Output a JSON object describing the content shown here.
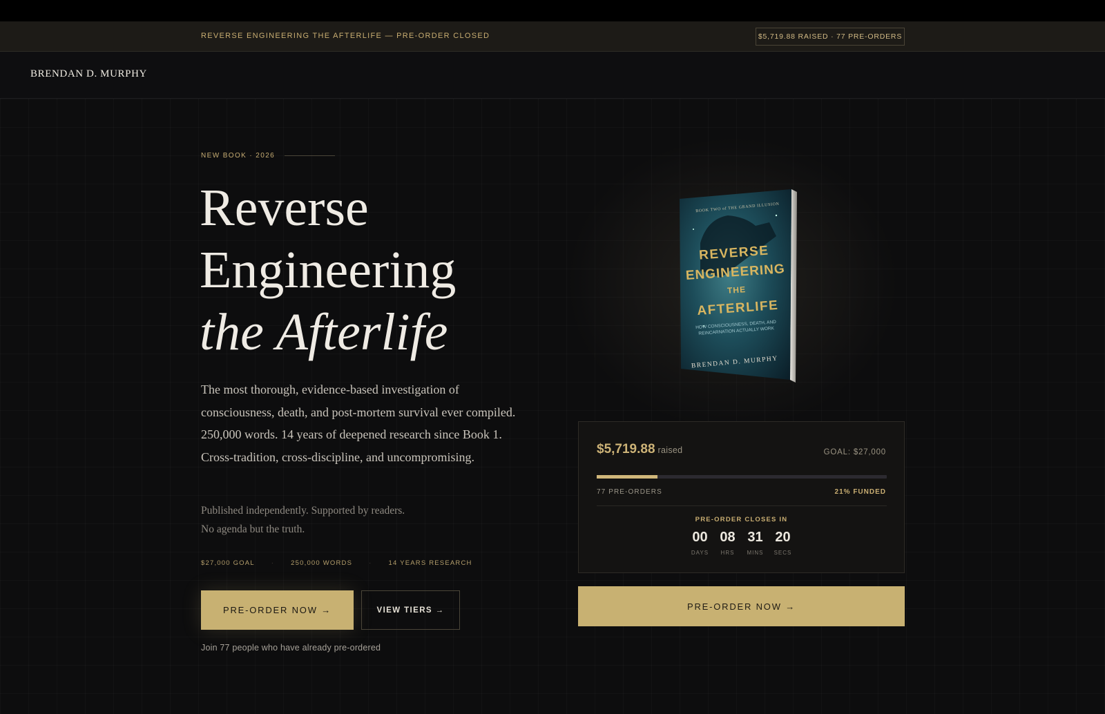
{
  "announcement": {
    "text": "REVERSE ENGINEERING THE AFTERLIFE — PRE-ORDER CLOSED",
    "badge": "$5,719.88 RAISED · 77 PRE-ORDERS"
  },
  "header": {
    "brand": "BRENDAN D. MURPHY"
  },
  "hero": {
    "eyebrow": "NEW BOOK · 2026",
    "title_line1": "Reverse",
    "title_line2": "Engineering",
    "title_line3": "the Afterlife",
    "description": "The most thorough, evidence-based investigation of consciousness, death, and post-mortem survival ever compiled. 250,000 words. 14 years of deepened research since Book 1. Cross-tradition, cross-discipline, and uncompromising.",
    "published_line1": "Published independently. Supported by readers.",
    "published_line2": "No agenda but the truth.",
    "stats": [
      "$27,000 GOAL",
      "250,000 WORDS",
      "14 YEARS RESEARCH"
    ],
    "stats_separator": "·",
    "primary_button": "PRE-ORDER NOW →",
    "secondary_button": "VIEW TIERS →",
    "join_text": "Join 77 people who have already pre-ordered"
  },
  "book_cover": {
    "series": "BOOK TWO of THE GRAND ILLUSION",
    "title_lines": [
      "REVERSE",
      "ENGINEERING",
      "THE",
      "AFTERLIFE"
    ],
    "subtitle_lines": [
      "HOW CONSCIOUSNESS, DEATH, AND",
      "REINCARNATION ACTUALLY WORK"
    ],
    "author": "BRENDAN D. MURPHY"
  },
  "funding": {
    "raised_amount": "$5,719.88",
    "raised_suffix": "raised",
    "goal": "GOAL: $27,000",
    "progress_fraction": 0.21,
    "preorders": "77 PRE-ORDERS",
    "funded": "21% FUNDED",
    "closes_label": "PRE-ORDER CLOSES IN",
    "countdown": [
      {
        "value": "00",
        "label": "DAYS"
      },
      {
        "value": "08",
        "label": "HRS"
      },
      {
        "value": "31",
        "label": "MINS"
      },
      {
        "value": "20",
        "label": "SECS"
      }
    ],
    "button": "PRE-ORDER NOW →"
  },
  "colors": {
    "accent": "#c8b172",
    "background": "#0d0d0e",
    "panel": "#141312"
  }
}
